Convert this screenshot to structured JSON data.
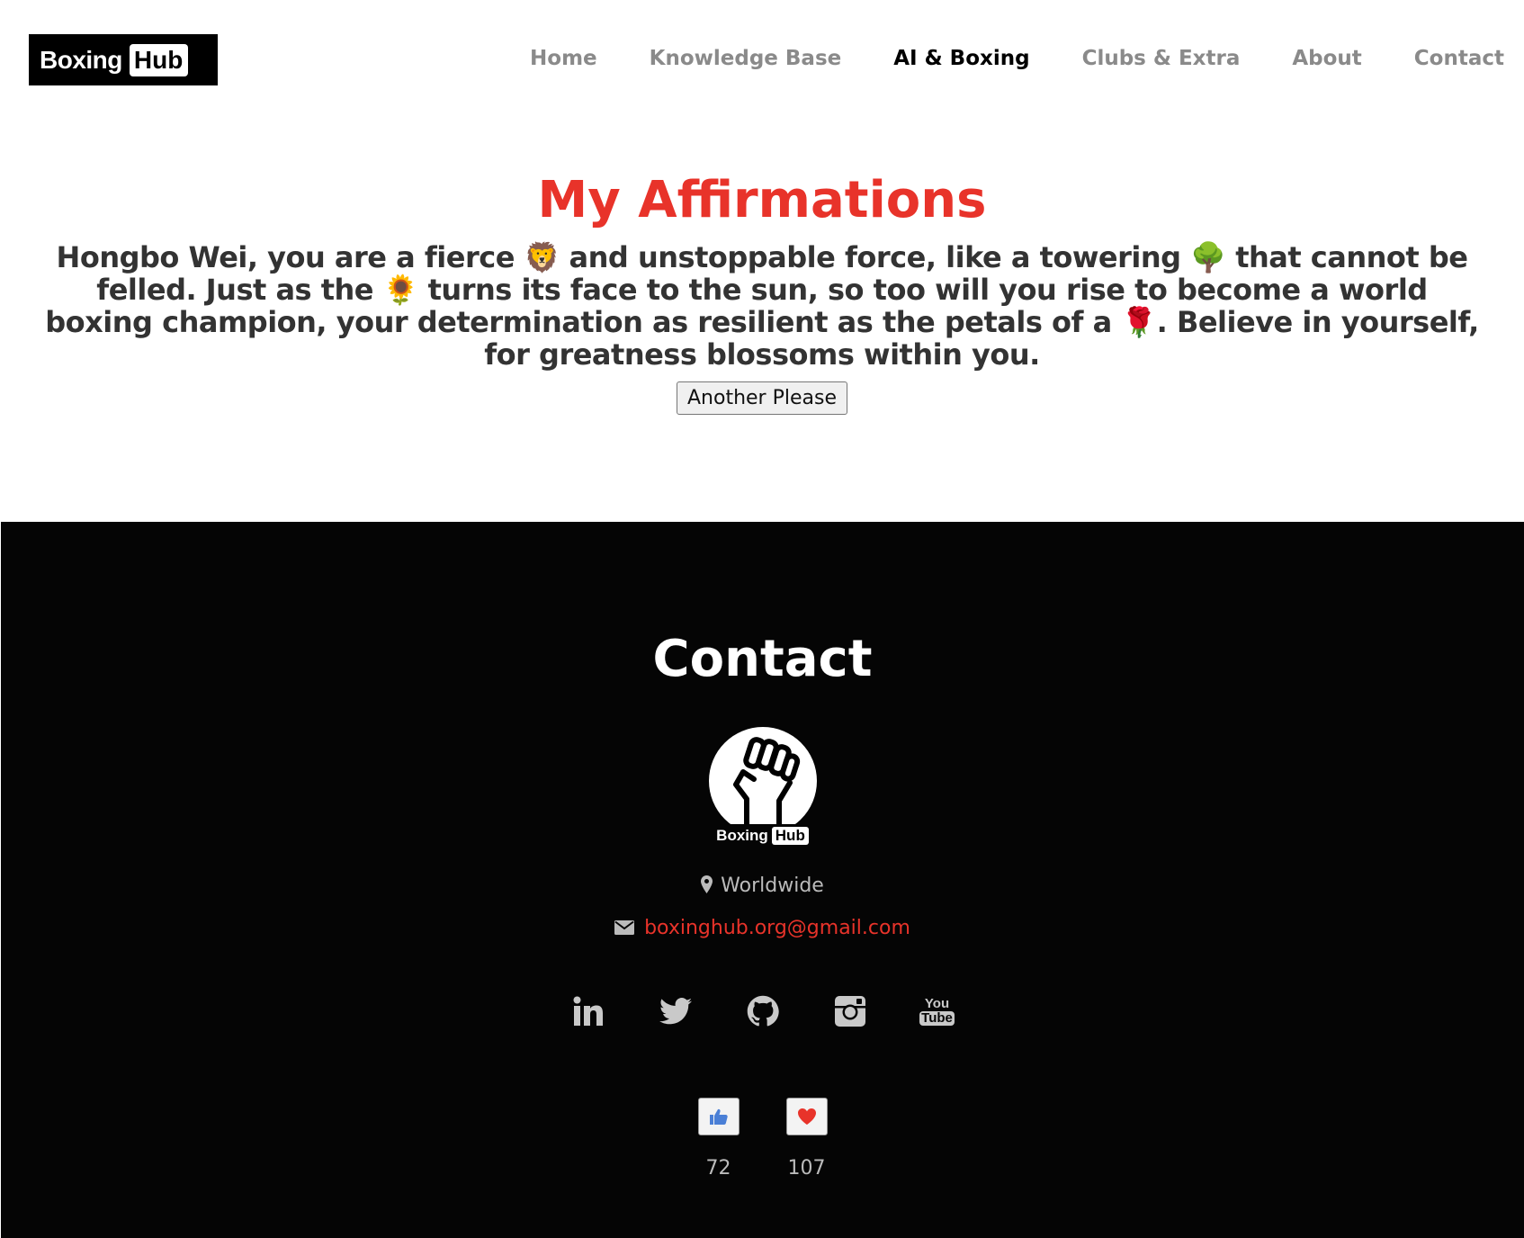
{
  "header": {
    "logo": {
      "left": "Boxing",
      "right": "Hub"
    },
    "nav": [
      {
        "label": "Home",
        "active": false
      },
      {
        "label": "Knowledge Base",
        "active": false
      },
      {
        "label": "AI & Boxing",
        "active": true
      },
      {
        "label": "Clubs & Extra",
        "active": false
      },
      {
        "label": "About",
        "active": false
      },
      {
        "label": "Contact",
        "active": false
      }
    ]
  },
  "main": {
    "title": "My Affirmations",
    "affirmation": "Hongbo Wei, you are a fierce 🦁 and unstoppable force, like a towering 🌳 that cannot be felled. Just as the 🌻 turns its face to the sun, so too will you rise to become a world boxing champion, your determination as resilient as the petals of a 🌹. Believe in yourself, for greatness blossoms within you.",
    "button_label": "Another Please"
  },
  "footer": {
    "title": "Contact",
    "logo": {
      "left": "Boxing",
      "right": "Hub"
    },
    "location": "Worldwide",
    "email": "boxinghub.org@gmail.com",
    "socials": [
      "linkedin-icon",
      "twitter-icon",
      "github-icon",
      "instagram-icon",
      "youtube-icon"
    ],
    "youtube_text": {
      "top": "You",
      "bottom": "Tube"
    },
    "likes": 72,
    "hearts": 107
  },
  "colors": {
    "accent_red": "#e8332a",
    "nav_gray": "#8a8a8a",
    "footer_bg": "#050505",
    "like_blue": "#4a7fd6"
  }
}
